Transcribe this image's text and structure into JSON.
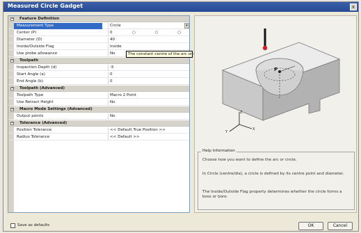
{
  "window": {
    "title": "Measured Circle Gadget",
    "close_glyph": "x"
  },
  "grid": {
    "rows": [
      {
        "type": "category",
        "label": "Feature Definition"
      },
      {
        "type": "prop",
        "key": "Measurement Type",
        "value": "Circle",
        "dropdown": true,
        "selected": true
      },
      {
        "type": "prop",
        "key": "Center (P)",
        "value": "0",
        "dots": "○ ○ ○"
      },
      {
        "type": "prop",
        "key": "Diameter (D)",
        "value": "40"
      },
      {
        "type": "prop",
        "key": "Inside/Outside Flag",
        "value": "Inside"
      },
      {
        "type": "prop",
        "key": "Use probe allowance",
        "value": "No"
      },
      {
        "type": "category",
        "label": "Toolpath"
      },
      {
        "type": "prop",
        "key": "Inspection Depth (d)",
        "value": "-5"
      },
      {
        "type": "prop",
        "key": "Start Angle (a)",
        "value": "0"
      },
      {
        "type": "prop",
        "key": "End Angle (b)",
        "value": "0"
      },
      {
        "type": "category",
        "label": "Toolpath (Advanced)"
      },
      {
        "type": "prop",
        "key": "Toolpath Type",
        "value": "Macro 2 Point"
      },
      {
        "type": "prop",
        "key": "Use Retract Height",
        "value": "No"
      },
      {
        "type": "category",
        "label": "Macro Mode Settings (Advanced)"
      },
      {
        "type": "prop",
        "key": "Output points",
        "value": "No"
      },
      {
        "type": "category",
        "label": "Tolerance (Advanced)"
      },
      {
        "type": "prop",
        "key": "Position Tolerance",
        "value": "<< Default True Position >>"
      },
      {
        "type": "prop",
        "key": "Radius Tolerance",
        "value": "<< Default >>"
      }
    ]
  },
  "tooltip": {
    "text": "The constant centre of the arc or circle"
  },
  "help": {
    "legend": "Help information",
    "paragraphs": [
      "Choose how you want to define the arc or circle.",
      "In Circle (centre/dia), a circle is defined by its centre point and diameter.",
      "The Inside/Outside Flag property determines whether the circle forms a boss or bore."
    ]
  },
  "footer": {
    "defaults_label": "Save as defaults",
    "ok_label": "OK",
    "cancel_label": "Cancel"
  },
  "diagram": {
    "axis_label_z": "Z",
    "axis_label_x": "X",
    "axis_label_y": "Y",
    "point_label": "P"
  }
}
